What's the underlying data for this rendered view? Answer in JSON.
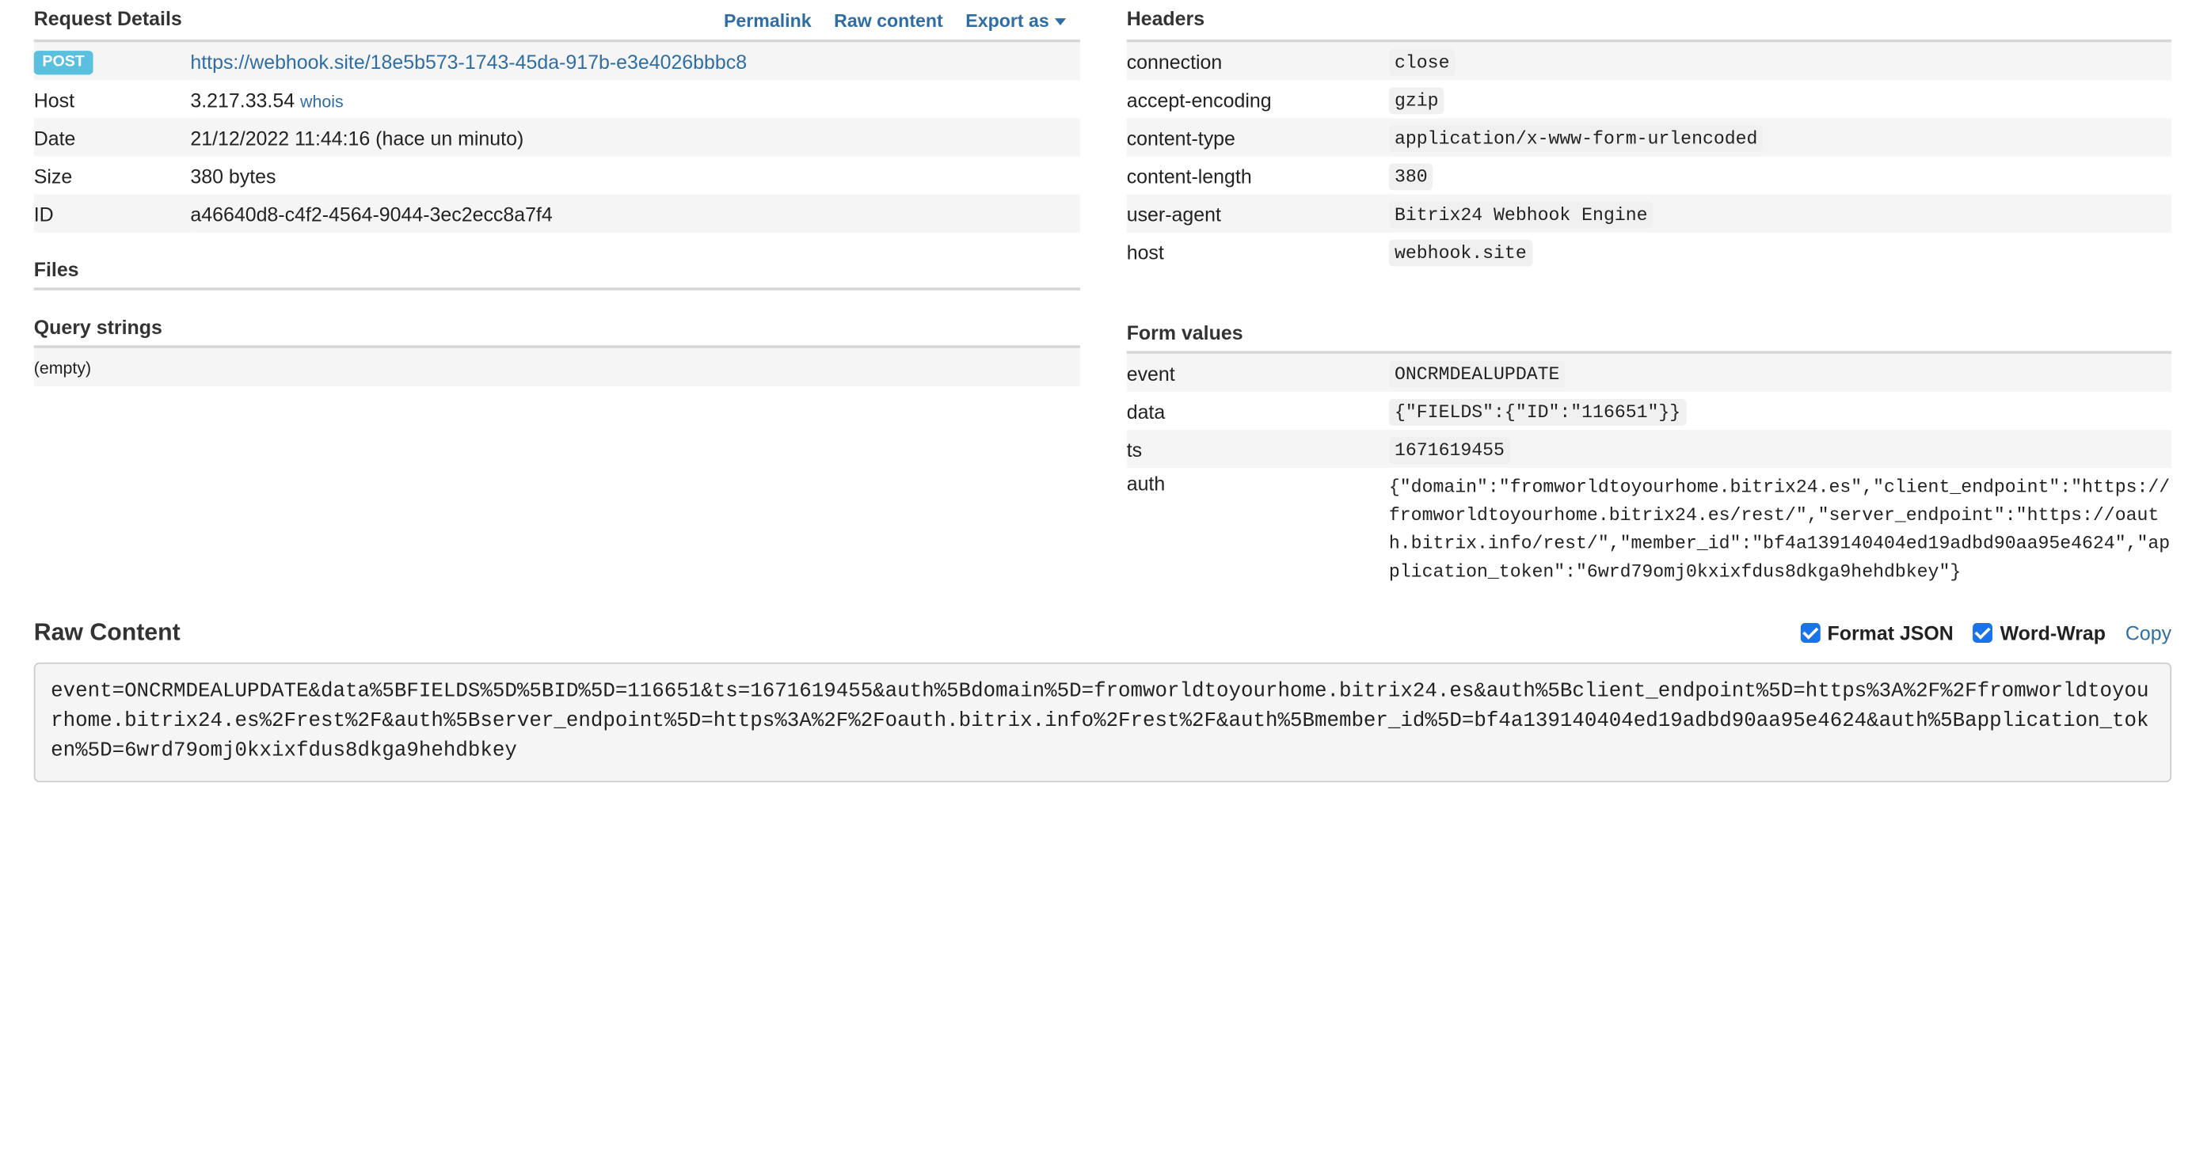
{
  "request_details": {
    "title": "Request Details",
    "links": {
      "permalink": "Permalink",
      "raw_content": "Raw content",
      "export_as": "Export as"
    },
    "method": "POST",
    "url": "https://webhook.site/18e5b573-1743-45da-917b-e3e4026bbbc8",
    "rows": {
      "host": {
        "key": "Host",
        "value": "3.217.33.54",
        "link": "whois"
      },
      "date": {
        "key": "Date",
        "value": "21/12/2022 11:44:16 (hace un minuto)"
      },
      "size": {
        "key": "Size",
        "value": "380 bytes"
      },
      "id": {
        "key": "ID",
        "value": "a46640d8-c4f2-4564-9044-3ec2ecc8a7f4"
      }
    }
  },
  "files": {
    "title": "Files"
  },
  "query_strings": {
    "title": "Query strings",
    "empty_text": "(empty)"
  },
  "headers": {
    "title": "Headers",
    "rows": [
      {
        "key": "connection",
        "value": "close"
      },
      {
        "key": "accept-encoding",
        "value": "gzip"
      },
      {
        "key": "content-type",
        "value": "application/x-www-form-urlencoded"
      },
      {
        "key": "content-length",
        "value": "380"
      },
      {
        "key": "user-agent",
        "value": "Bitrix24 Webhook Engine"
      },
      {
        "key": "host",
        "value": "webhook.site"
      }
    ]
  },
  "form_values": {
    "title": "Form values",
    "rows": [
      {
        "key": "event",
        "value": "ONCRMDEALUPDATE"
      },
      {
        "key": "data",
        "value": "{\"FIELDS\":{\"ID\":\"116651\"}}"
      },
      {
        "key": "ts",
        "value": "1671619455"
      },
      {
        "key": "auth",
        "value": "{\"domain\":\"fromworldtoyourhome.bitrix24.es\",\"client_endpoint\":\"https://fromworldtoyourhome.bitrix24.es/rest/\",\"server_endpoint\":\"https://oauth.bitrix.info/rest/\",\"member_id\":\"bf4a139140404ed19adbd90aa95e4624\",\"application_token\":\"6wrd79omj0kxixfdus8dkga9hehdbkey\"}"
      }
    ]
  },
  "raw_content": {
    "title": "Raw Content",
    "format_json_label": "Format JSON",
    "format_json_checked": true,
    "word_wrap_label": "Word-Wrap",
    "word_wrap_checked": true,
    "copy_label": "Copy",
    "body": "event=ONCRMDEALUPDATE&data%5BFIELDS%5D%5BID%5D=116651&ts=1671619455&auth%5Bdomain%5D=fromworldtoyourhome.bitrix24.es&auth%5Bclient_endpoint%5D=https%3A%2F%2Ffromworldtoyourhome.bitrix24.es%2Frest%2F&auth%5Bserver_endpoint%5D=https%3A%2F%2Foauth.bitrix.info%2Frest%2F&auth%5Bmember_id%5D=bf4a139140404ed19adbd90aa95e4624&auth%5Bapplication_token%5D=6wrd79omj0kxixfdus8dkga9hehdbkey"
  },
  "colors": {
    "link": "#2f6ea5",
    "badge_post": "#5bc0de",
    "row_stripe": "#f5f5f5",
    "checkbox": "#1a73e8"
  }
}
